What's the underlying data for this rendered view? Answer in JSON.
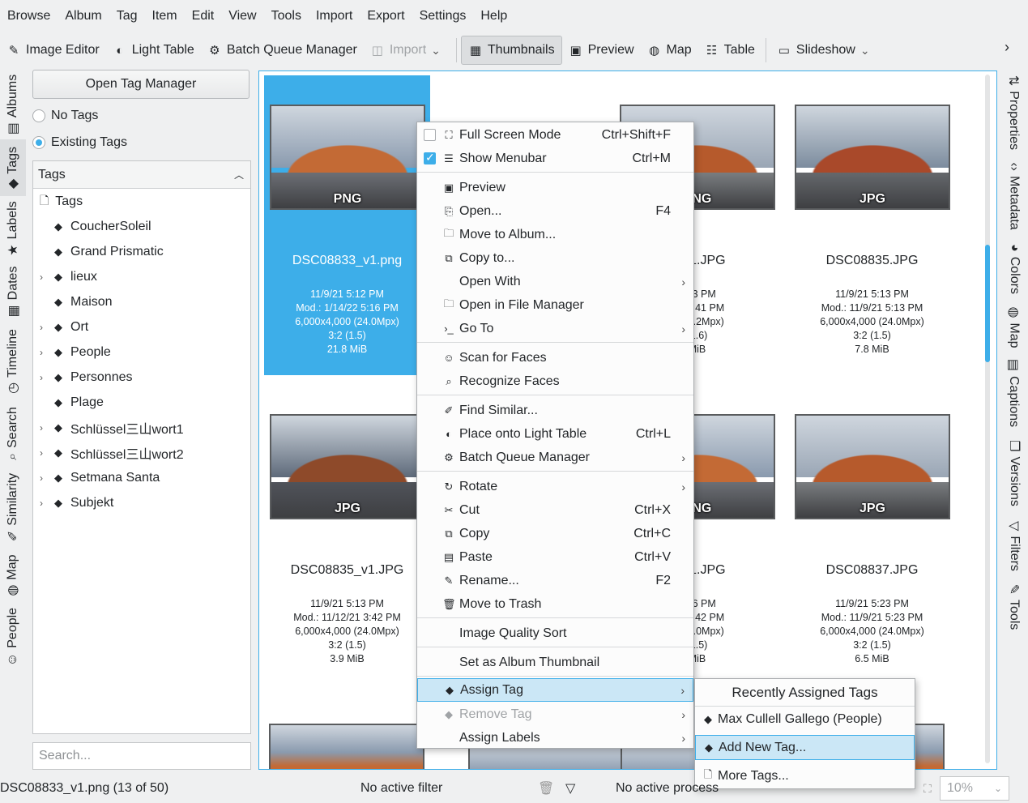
{
  "menubar": [
    "Browse",
    "Album",
    "Tag",
    "Item",
    "Edit",
    "View",
    "Tools",
    "Import",
    "Export",
    "Settings",
    "Help"
  ],
  "toolbar": {
    "image_editor": "Image Editor",
    "light_table": "Light Table",
    "batch_queue": "Batch Queue Manager",
    "import": "Import",
    "thumbnails": "Thumbnails",
    "preview": "Preview",
    "map": "Map",
    "table": "Table",
    "slideshow": "Slideshow"
  },
  "left_tabs": [
    "Albums",
    "Tags",
    "Labels",
    "Dates",
    "Timeline",
    "Search",
    "Similarity",
    "Map",
    "People"
  ],
  "right_tabs": [
    "Properties",
    "Metadata",
    "Colors",
    "Map",
    "Captions",
    "Versions",
    "Filters",
    "Tools"
  ],
  "tag_panel": {
    "open_button": "Open Tag Manager",
    "no_tags": "No Tags",
    "existing_tags": "Existing Tags",
    "header": "Tags",
    "root": "Tags",
    "items": [
      "CoucherSoleil",
      "Grand Prismatic",
      "lieux",
      "Maison",
      "Ort",
      "People",
      "Personnes",
      "Plage",
      "Schlüssel三山wort1",
      "Schlüssel三山wort2",
      "Setmana Santa",
      "Subjekt"
    ],
    "search_placeholder": "Search..."
  },
  "thumbnails": [
    {
      "badge": "PNG",
      "name": "DSC08833_v1.png",
      "date": "11/9/21 5:12 PM",
      "mod": "Mod.: 1/14/22 5:16 PM",
      "dims": "6,000x4,000 (24.0Mpx)",
      "ratio": "3:2 (1.5)",
      "size": "21.8 MiB"
    },
    {
      "badge": "PNG",
      "name": "4_v1.JPG",
      "date": "5:13 PM",
      "mod": "/21 3:41 PM",
      "dims": "8 (22.2Mpx)",
      "ratio": "(1.6)",
      "size": "MiB"
    },
    {
      "badge": "JPG",
      "name": "DSC08835.JPG",
      "date": "11/9/21 5:13 PM",
      "mod": "Mod.: 11/9/21 5:13 PM",
      "dims": "6,000x4,000 (24.0Mpx)",
      "ratio": "3:2 (1.5)",
      "size": "7.8 MiB"
    },
    {
      "badge": "JPG",
      "name": "DSC08835_v1.JPG",
      "date": "11/9/21 5:13 PM",
      "mod": "Mod.: 11/12/21 3:42 PM",
      "dims": "6,000x4,000 (24.0Mpx)",
      "ratio": "3:2 (1.5)",
      "size": "3.9 MiB"
    },
    {
      "badge": "PNG",
      "name": "6_v1.JPG",
      "date": "5:16 PM",
      "mod": "/21 3:42 PM",
      "dims": "0 (24.0Mpx)",
      "ratio": "(1.5)",
      "size": "MiB"
    },
    {
      "badge": "JPG",
      "name": "DSC08837.JPG",
      "date": "11/9/21 5:23 PM",
      "mod": "Mod.: 11/9/21 5:23 PM",
      "dims": "6,000x4,000 (24.0Mpx)",
      "ratio": "3:2 (1.5)",
      "size": "6.5 MiB"
    }
  ],
  "context_menu": {
    "full_screen": "Full Screen Mode",
    "full_screen_sc": "Ctrl+Shift+F",
    "show_menubar": "Show Menubar",
    "show_menubar_sc": "Ctrl+M",
    "preview": "Preview",
    "open": "Open...",
    "open_sc": "F4",
    "move_to_album": "Move to Album...",
    "copy_to": "Copy to...",
    "open_with": "Open With",
    "open_in_fm": "Open in File Manager",
    "go_to": "Go To",
    "scan_faces": "Scan for Faces",
    "recognize_faces": "Recognize Faces",
    "find_similar": "Find Similar...",
    "place_light_table": "Place onto Light Table",
    "place_light_table_sc": "Ctrl+L",
    "batch_queue": "Batch Queue Manager",
    "rotate": "Rotate",
    "cut": "Cut",
    "cut_sc": "Ctrl+X",
    "copy": "Copy",
    "copy_sc": "Ctrl+C",
    "paste": "Paste",
    "paste_sc": "Ctrl+V",
    "rename": "Rename...",
    "rename_sc": "F2",
    "move_trash": "Move to Trash",
    "quality_sort": "Image Quality Sort",
    "album_thumb": "Set as Album Thumbnail",
    "assign_tag": "Assign Tag",
    "remove_tag": "Remove Tag",
    "assign_labels": "Assign Labels"
  },
  "submenu": {
    "header": "Recently Assigned Tags",
    "recent": "Max Cullell Gallego (People)",
    "add_new": "Add New Tag...",
    "more": "More Tags..."
  },
  "status": {
    "file": "DSC08833_v1.png (13 of 50)",
    "filter": "No active filter",
    "process": "No active process",
    "zoom": "10%"
  },
  "colors": {
    "accent": "#3daee9",
    "highlight": "#cbe7f6"
  }
}
